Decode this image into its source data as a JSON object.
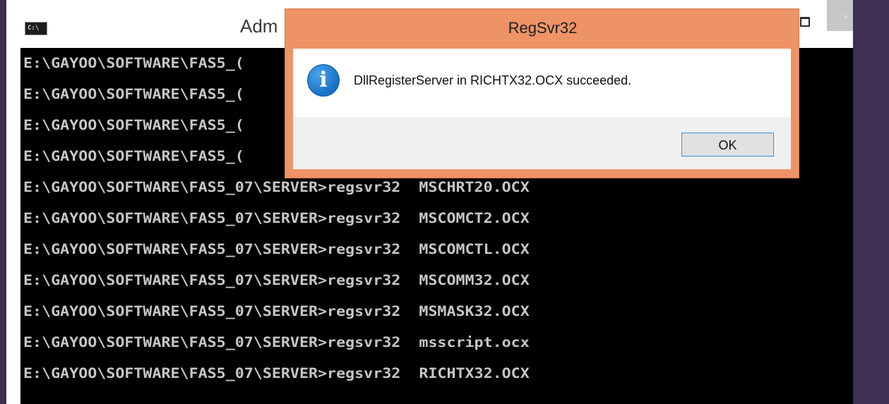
{
  "console": {
    "app_icon_text": "C:\\",
    "title": "Adm",
    "lines": [
      "E:\\GAYOO\\SOFTWARE\\FAS5_(",
      "E:\\GAYOO\\SOFTWARE\\FAS5_(",
      "E:\\GAYOO\\SOFTWARE\\FAS5_(",
      "E:\\GAYOO\\SOFTWARE\\FAS5_(",
      "E:\\GAYOO\\SOFTWARE\\FAS5_07\\SERVER>regsvr32  MSCHRT20.OCX",
      "E:\\GAYOO\\SOFTWARE\\FAS5_07\\SERVER>regsvr32  MSCOMCT2.OCX",
      "E:\\GAYOO\\SOFTWARE\\FAS5_07\\SERVER>regsvr32  MSCOMCTL.OCX",
      "E:\\GAYOO\\SOFTWARE\\FAS5_07\\SERVER>regsvr32  MSCOMM32.OCX",
      "E:\\GAYOO\\SOFTWARE\\FAS5_07\\SERVER>regsvr32  MSMASK32.OCX",
      "E:\\GAYOO\\SOFTWARE\\FAS5_07\\SERVER>regsvr32  msscript.ocx",
      "E:\\GAYOO\\SOFTWARE\\FAS5_07\\SERVER>regsvr32  RICHTX32.OCX"
    ]
  },
  "dialog": {
    "title": "RegSvr32",
    "message": "DllRegisterServer in RICHTX32.OCX succeeded.",
    "ok_label": "OK",
    "icon": "info-icon",
    "icon_glyph": "i"
  },
  "colors": {
    "dialog_frame": "#ee9366",
    "console_background": "#000000",
    "console_text": "#c6c6c6",
    "desktop": "#3f2f52"
  }
}
